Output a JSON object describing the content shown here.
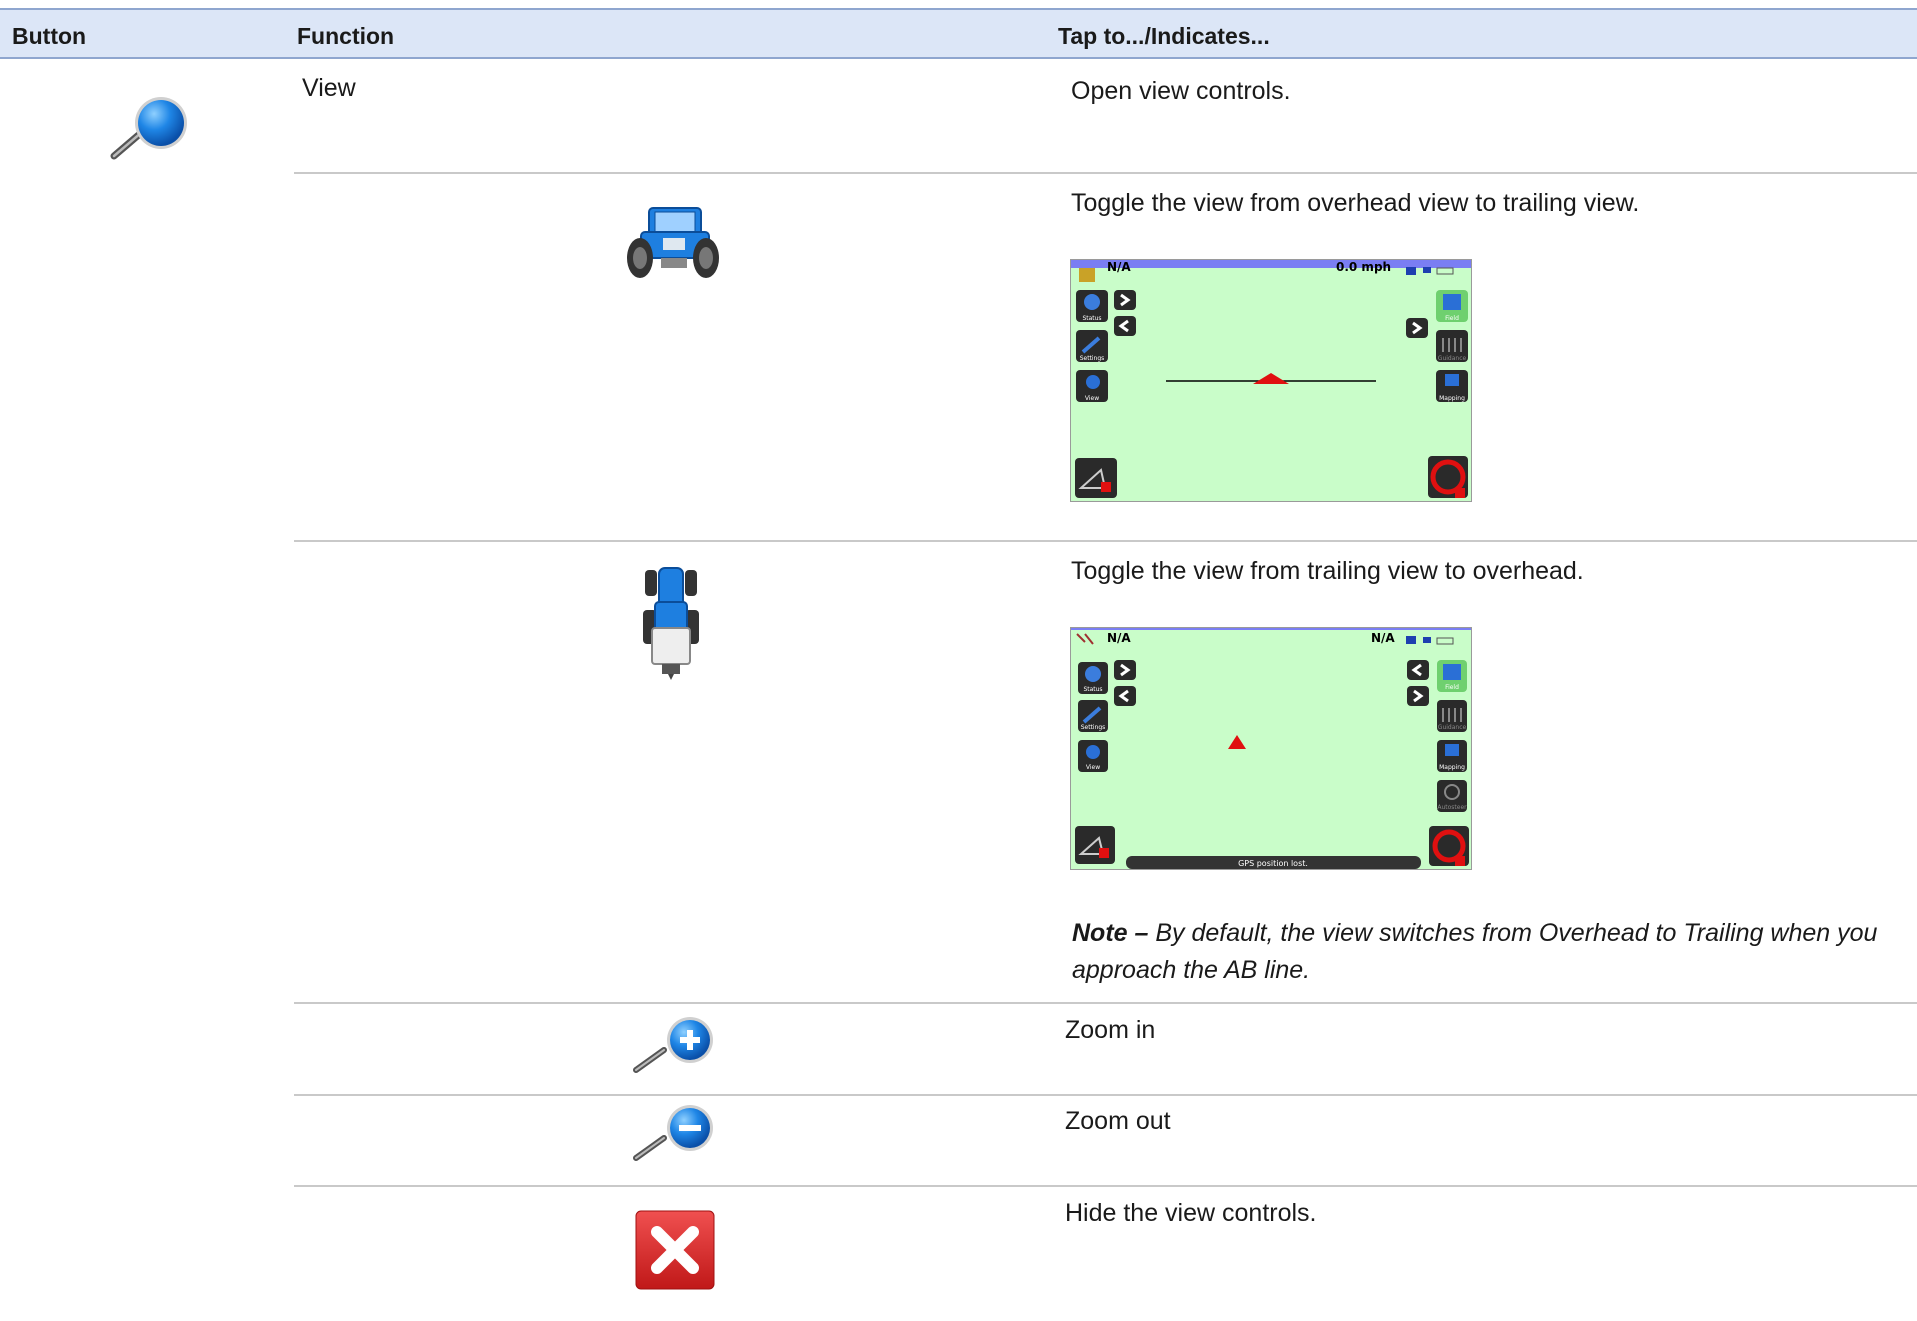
{
  "table": {
    "headers": {
      "button": "Button",
      "function": "Function",
      "tap": "Tap to.../Indicates..."
    },
    "rows": [
      {
        "icon": "magnifier-icon",
        "function": "View",
        "description": "Open view controls."
      },
      {
        "icon": "tractor-trailing-icon",
        "description": "Toggle the view from overhead view to trailing view."
      },
      {
        "icon": "tractor-overhead-icon",
        "description": "Toggle the view from trailing view to overhead.",
        "note_label": "Note –",
        "note_text": "By default, the view switches from Overhead to Trailing when you approach the AB line."
      },
      {
        "icon": "zoom-in-icon",
        "description": "Zoom in"
      },
      {
        "icon": "zoom-out-icon",
        "description": "Zoom out"
      },
      {
        "icon": "close-icon",
        "description": "Hide the view controls."
      }
    ]
  },
  "screen1": {
    "left_status": "N/A",
    "speed": "0.0 mph",
    "status_label": "Status",
    "settings_label": "Settings",
    "view_label": "View",
    "field_label": "Field",
    "guidance_label": "Guidance",
    "mapping_label": "Mapping"
  },
  "screen2": {
    "left_status": "N/A",
    "right_status": "N/A",
    "status_label": "Status",
    "settings_label": "Settings",
    "view_label": "View",
    "field_label": "Field",
    "guidance_label": "Guidance",
    "mapping_label": "Mapping",
    "autosteer_label": "Autosteer",
    "gps_message": "GPS position lost."
  },
  "colors": {
    "header_bg": "#dce6f7",
    "field_green": "#c9fdc9",
    "bar_blue": "#7a7ef3",
    "marker_red": "#e01010",
    "icon_blue": "#1e7fe0"
  }
}
